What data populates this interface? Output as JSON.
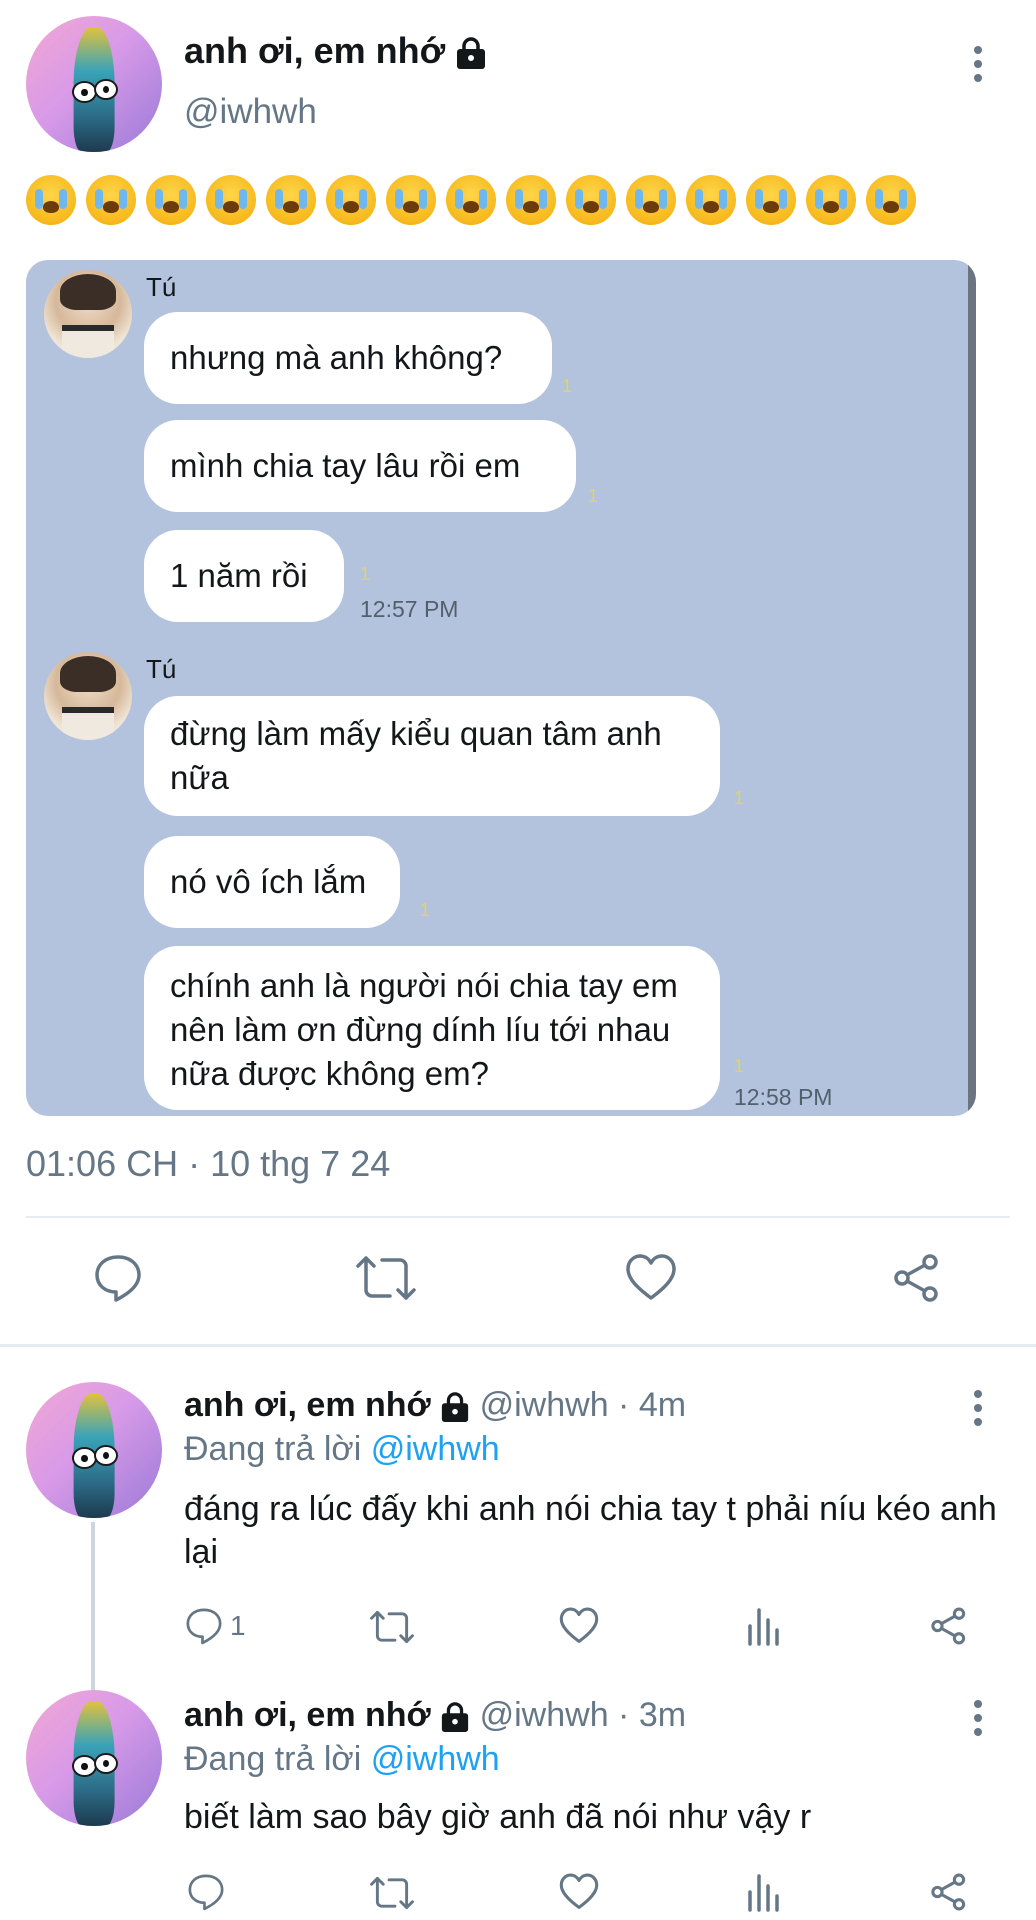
{
  "tweet": {
    "display_name": "anh ơi, em nhớ",
    "handle": "@iwhwh",
    "emoji_count": 15,
    "emoji_name": "loudly-crying-face",
    "timestamp": "01:06 CH · 10 thg 7 24"
  },
  "chat_screenshot": {
    "groups": [
      {
        "sender": "Tú",
        "messages": [
          {
            "text": "nhưng mà anh không?",
            "read": "1"
          },
          {
            "text": "mình chia tay lâu rồi em",
            "read": "1"
          },
          {
            "text": "1 năm rồi",
            "read": "1",
            "time": "12:57 PM"
          }
        ]
      },
      {
        "sender": "Tú",
        "messages": [
          {
            "text": "đừng làm mấy kiểu quan tâm anh nữa",
            "read": "1"
          },
          {
            "text": "nó vô ích lắm",
            "read": "1"
          },
          {
            "text": " chính anh là người nói chia tay em nên làm ơn đừng dính líu tới nhau nữa được không em?",
            "read": "1",
            "time": "12:58 PM"
          }
        ]
      }
    ]
  },
  "actions": {
    "reply_icon": "reply-icon",
    "retweet_icon": "retweet-icon",
    "like_icon": "heart-icon",
    "share_icon": "share-icon",
    "views_icon": "views-icon"
  },
  "replies": [
    {
      "display_name": "anh ơi, em nhớ",
      "handle_time": "@iwhwh · 4m",
      "replying_prefix": "Đang trả lời",
      "replying_handle": "@iwhwh",
      "text": "đáng ra lúc đấy khi anh nói chia tay t phải níu kéo anh lại",
      "reply_count": "1"
    },
    {
      "display_name": "anh ơi, em nhớ",
      "handle_time": "@iwhwh · 3m",
      "replying_prefix": "Đang trả lời",
      "replying_handle": "@iwhwh",
      "text": "biết làm sao bây giờ anh đã nói như vậy r",
      "reply_count": ""
    }
  ],
  "colors": {
    "chat_background": "#b3c3dd",
    "link": "#1da1f2",
    "secondary_text": "#657786"
  }
}
